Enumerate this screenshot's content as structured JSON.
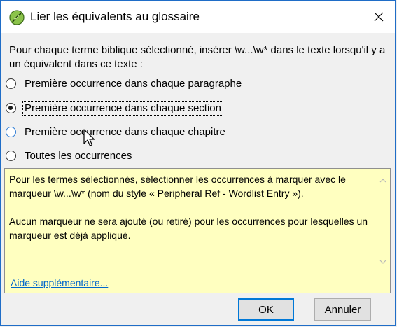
{
  "window": {
    "title": "Lier les équivalents au glossaire"
  },
  "intro": {
    "text": "Pour chaque terme biblique sélectionné, insérer \\w...\\w* dans le texte lorsqu'il y a un équivalent dans ce texte :"
  },
  "options": [
    {
      "label": "Première occurrence dans chaque paragraphe",
      "checked": false
    },
    {
      "label": "Première occurrence dans chaque section",
      "checked": true
    },
    {
      "label": "Première occurrence dans chaque chapitre",
      "checked": false
    },
    {
      "label": "Toutes les occurrences",
      "checked": false
    }
  ],
  "info": {
    "paragraph1": "Pour les termes sélectionnés, sélectionner les occurrences à marquer avec le marqueur \\w...\\w* (nom du style « Peripheral Ref - Wordlist Entry »).",
    "paragraph2": "Aucun marqueur ne sera ajouté (ou retiré) pour les occurrences pour lesquelles un marqueur est déjà appliqué.",
    "help_link": "Aide supplémentaire..."
  },
  "buttons": {
    "ok": "OK",
    "cancel": "Annuler"
  },
  "colors": {
    "info_background": "#ffffc0",
    "link": "#0066cc",
    "accent": "#0078d7"
  }
}
